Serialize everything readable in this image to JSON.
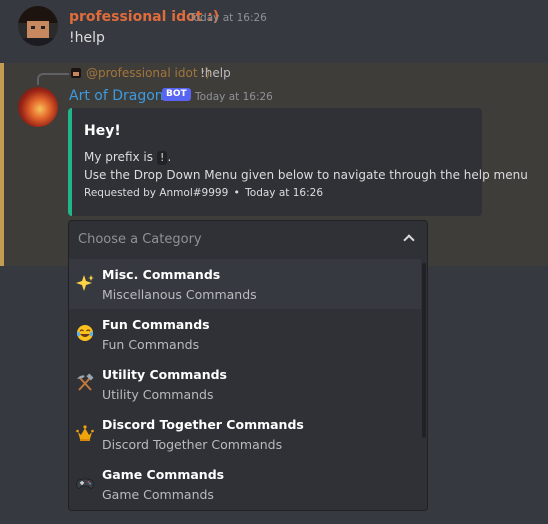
{
  "message1": {
    "author": "professional idot :)",
    "timestamp": "Today at 16:26",
    "content": "!help"
  },
  "message2": {
    "reply": {
      "mention": "@professional idot :)",
      "text": "!help"
    },
    "author": "Art of Dragons",
    "badge": "BOT",
    "timestamp": "Today at 16:26",
    "embed": {
      "title": "Hey!",
      "desc_line1_prefix": "My prefix is",
      "prefix_code": "!",
      "desc_line1_suffix": ".",
      "desc_line2": "Use the Drop Down Menu given below to navigate through the help menu",
      "footer_author": "Requested by Anmol#9999",
      "footer_separator": "•",
      "footer_time": "Today at 16:26",
      "accent_color": "#1fb68c"
    }
  },
  "select": {
    "placeholder": "Choose a Category",
    "options": [
      {
        "icon": "sparkles-icon",
        "label": "Misc. Commands",
        "description": "Miscellanous Commands"
      },
      {
        "icon": "joy-face-icon",
        "label": "Fun Commands",
        "description": "Fun Commands"
      },
      {
        "icon": "hammer-pick-icon",
        "label": "Utility Commands",
        "description": "Utility Commands"
      },
      {
        "icon": "crown-icon",
        "label": "Discord Together Commands",
        "description": "Discord Together Commands"
      },
      {
        "icon": "game-controller-icon",
        "label": "Game Commands",
        "description": "Game Commands"
      }
    ]
  },
  "colors": {
    "background": "#36393f",
    "highlight_bg": "#3f3d39",
    "highlight_border": "#c39c52",
    "user1_name": "#e06c3c",
    "bot_name": "#3a9be3",
    "bot_badge": "#5865f2"
  }
}
